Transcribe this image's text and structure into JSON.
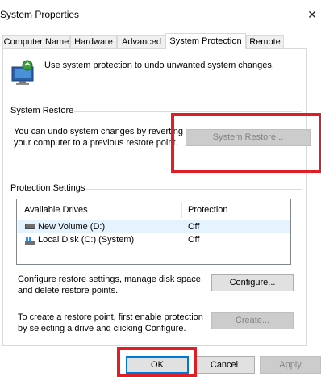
{
  "window": {
    "title": "System Properties"
  },
  "tabs": [
    {
      "label": "Computer Name"
    },
    {
      "label": "Hardware"
    },
    {
      "label": "Advanced"
    },
    {
      "label": "System Protection"
    },
    {
      "label": "Remote"
    }
  ],
  "intro": {
    "text": "Use system protection to undo unwanted system changes."
  },
  "system_restore": {
    "heading": "System Restore",
    "line1": "You can undo system changes by reverting",
    "line2": "your computer to a previous restore point.",
    "button": "System Restore..."
  },
  "protection": {
    "heading": "Protection Settings",
    "columns": [
      "Available Drives",
      "Protection"
    ],
    "drives": [
      {
        "name": "New Volume (D:)",
        "protection": "Off"
      },
      {
        "name": "Local Disk (C:) (System)",
        "protection": "Off"
      }
    ],
    "configure_line1": "Configure restore settings, manage disk space,",
    "configure_line2": "and delete restore points.",
    "configure_button": "Configure...",
    "create_line1": "To create a restore point, first enable protection",
    "create_line2": "by selecting a drive and clicking Configure.",
    "create_button": "Create..."
  },
  "footer": {
    "ok": "OK",
    "cancel": "Cancel",
    "apply": "Apply"
  },
  "colors": {
    "highlight_box": "#e11d25",
    "accent": "#0078d7"
  }
}
